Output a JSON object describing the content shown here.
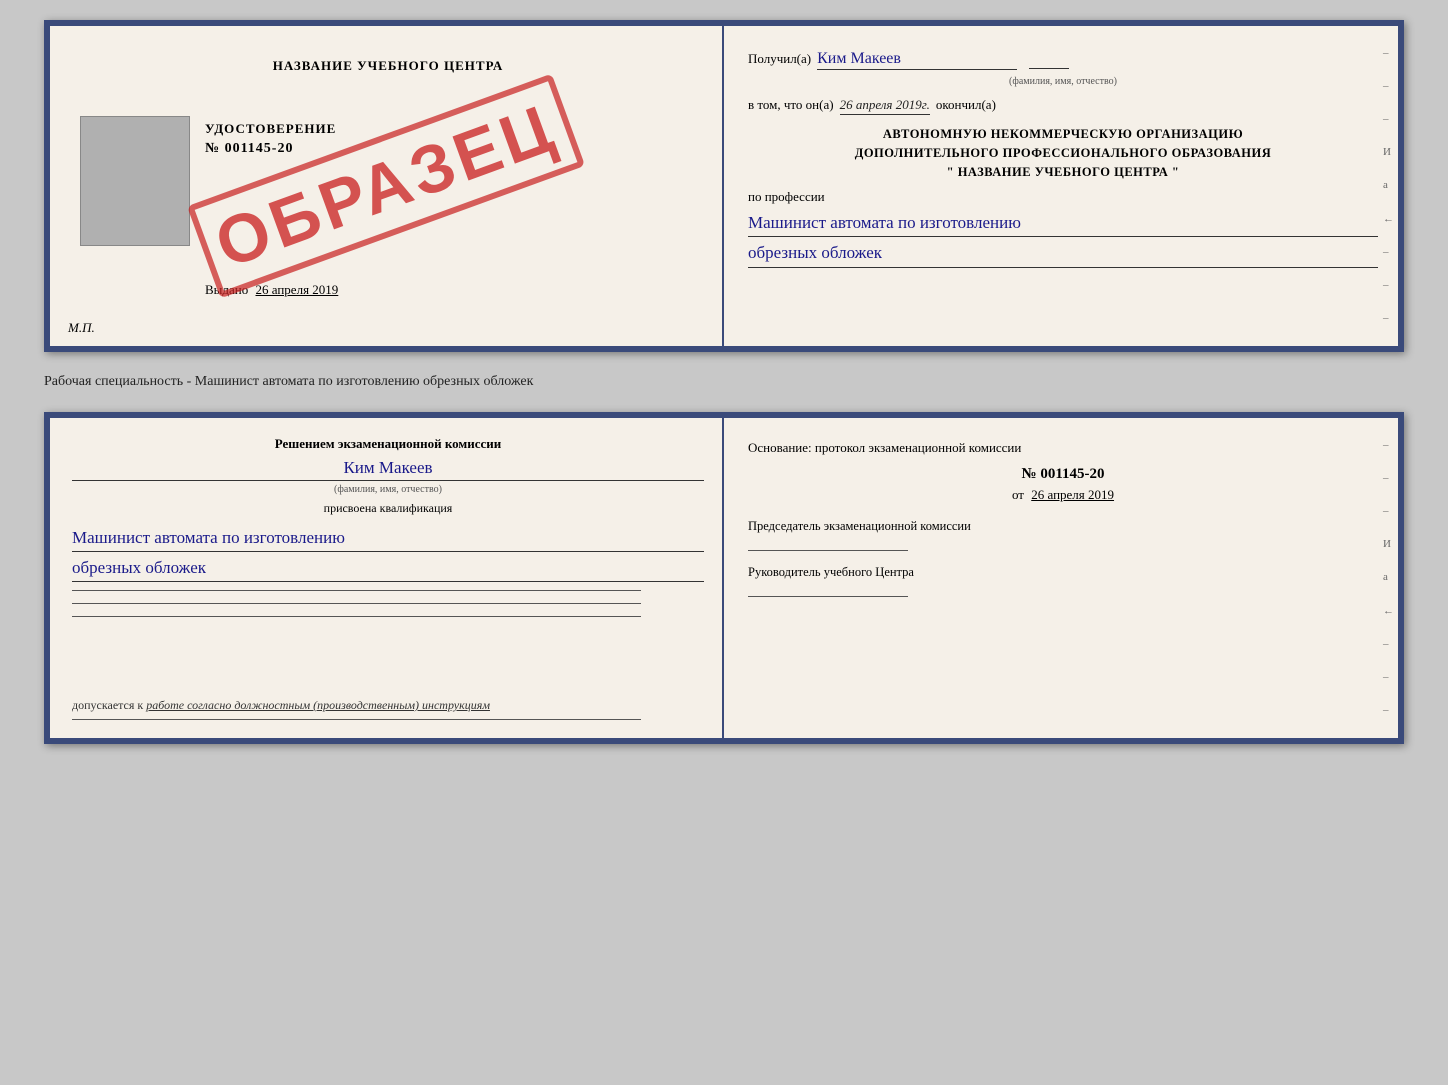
{
  "top_document": {
    "left": {
      "training_center": "НАЗВАНИЕ УЧЕБНОГО ЦЕНТРА",
      "udostoverenie_label": "УДОСТОВЕРЕНИЕ",
      "number": "№ 001145-20",
      "vydano_label": "Выдано",
      "vydano_date": "26 апреля 2019",
      "mp_label": "М.П.",
      "obrazec": "ОБРАЗЕЦ"
    },
    "right": {
      "poluchil_label": "Получил(а)",
      "recipient_name": "Ким Макеев",
      "fio_hint": "(фамилия, имя, отчество)",
      "vtom_label": "в том, что он(а)",
      "vtom_date": "26 апреля 2019г.",
      "okoncil_label": "окончил(а)",
      "org_line1": "АВТОНОМНУЮ НЕКОММЕРЧЕСКУЮ ОРГАНИЗАЦИЮ",
      "org_line2": "ДОПОЛНИТЕЛЬНОГО ПРОФЕССИОНАЛЬНОГО ОБРАЗОВАНИЯ",
      "org_line3": "\"  НАЗВАНИЕ УЧЕБНОГО ЦЕНТРА  \"",
      "po_professii_label": "по профессии",
      "profession_line1": "Машинист автомата по изготовлению",
      "profession_line2": "обрезных обложек",
      "side_ticks": [
        "–",
        "–",
        "–",
        "И",
        "а",
        "←",
        "–",
        "–",
        "–"
      ]
    }
  },
  "description": "Рабочая специальность - Машинист автомата по изготовлению обрезных обложек",
  "bottom_document": {
    "left": {
      "resheniem_label": "Решением экзаменационной комиссии",
      "person_name": "Ким Макеев",
      "fio_hint": "(фамилия, имя, отчество)",
      "prisvoena_label": "присвоена квалификация",
      "qualification_line1": "Машинист автомата по изготовлению",
      "qualification_line2": "обрезных обложек",
      "dopuskaetsya_prefix": "допускается к",
      "dopuskaetsya_text": "работе согласно должностным (производственным) инструкциям"
    },
    "right": {
      "osnovanie_label": "Основание: протокол экзаменационной комиссии",
      "protocol_number": "№  001145-20",
      "ot_label": "от",
      "ot_date": "26 апреля 2019",
      "predsedatel_label": "Председатель экзаменационной комиссии",
      "rukovoditel_label": "Руководитель учебного Центра",
      "side_ticks": [
        "–",
        "–",
        "–",
        "И",
        "а",
        "←",
        "–",
        "–",
        "–"
      ]
    }
  }
}
